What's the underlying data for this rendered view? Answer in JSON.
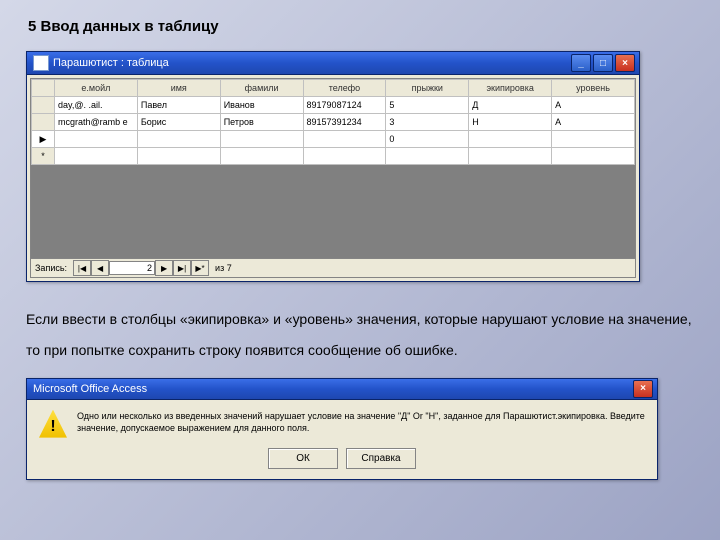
{
  "heading": "5 Ввод данных в таблицу",
  "tableWin": {
    "title": "Парашютист : таблица",
    "columns": [
      "е.мойл",
      "имя",
      "фамили",
      "телефо",
      "прыжки",
      "экипировка",
      "уровень"
    ],
    "rows": [
      {
        "rowhdr": "",
        "cells": [
          "day,@. .ail.",
          "Павел",
          "Иванов",
          "89179087124",
          "5",
          "Д",
          "А"
        ]
      },
      {
        "rowhdr": "",
        "cells": [
          "mcgrath@ramb е",
          "Борис",
          "Петров",
          "89157391234",
          "3",
          "Н",
          "А"
        ]
      },
      {
        "rowhdr": "▶",
        "cells": [
          "",
          "",
          "",
          "",
          "0",
          "",
          ""
        ]
      },
      {
        "rowhdr": "*",
        "cells": [
          "",
          "",
          "",
          "",
          "",
          "",
          ""
        ]
      }
    ],
    "nav": {
      "label": "Запись:",
      "first": "|◀",
      "prev": "◀",
      "pos": "2",
      "next": "▶",
      "last": "▶|",
      "new": "▶*",
      "of": "из  7"
    }
  },
  "paragraph": "Если ввести в столбцы «экипировка» и «уровень» значения, которые нарушают условие на значение, то при попытке сохранить строку появится сообщение об ошибке.",
  "dlg": {
    "title": "Microsoft Office Access",
    "msg": "Одно или несколько из введенных значений нарушает условие на значение \"Д\" Or \"Н\", заданное для Парашютист.экипировка. Введите значение, допускаемое выражением для данного поля.",
    "ok": "ОК",
    "help": "Справка"
  },
  "winbtns": {
    "min": "_",
    "max": "□",
    "close": "×"
  }
}
